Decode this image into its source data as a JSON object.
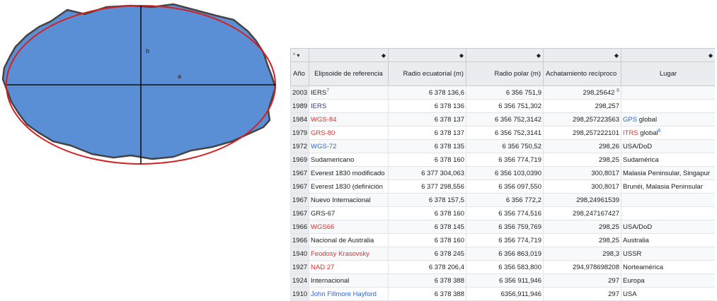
{
  "diagram": {
    "label_a": "a",
    "label_b": "b",
    "colors": {
      "fill": "#5a8fd6",
      "outline": "#444444",
      "ellipse": "#d42020"
    }
  },
  "table": {
    "sort_row": {
      "first": "° ▾",
      "sort_icon": "◆"
    },
    "headers": {
      "year": "Año",
      "ellipsoid": "Elipsoide de referencia",
      "equatorial": "Radio ecuatorial (m)",
      "polar": "Radio polar (m)",
      "flattening": "Achatamiento recíproco",
      "place": "Lugar"
    },
    "rows": [
      {
        "year": "2003",
        "name": "IERS",
        "name_sup": "7",
        "name_color": "plain",
        "eq": "6 378 136,6",
        "polar": "6 356 751,9",
        "flat": "298,25642",
        "flat_sup": "6",
        "place": "",
        "place_link": "",
        "place_tail": "",
        "place_sup": ""
      },
      {
        "year": "1989",
        "name": "IERS",
        "name_sup": "",
        "name_color": "blue-dark",
        "eq": "6 378 136",
        "polar": "6 356 751,302",
        "flat": "298,257",
        "flat_sup": "",
        "place": "",
        "place_link": "",
        "place_tail": "",
        "place_sup": ""
      },
      {
        "year": "1984",
        "name": "WGS-84",
        "name_sup": "",
        "name_color": "red",
        "eq": "6 378 137",
        "polar": "6 356 752,3142",
        "flat": "298,257223563",
        "flat_sup": "",
        "place": "",
        "place_link": "GPS",
        "place_tail": " global",
        "place_sup": ""
      },
      {
        "year": "1979",
        "name": "GRS-80",
        "name_sup": "",
        "name_color": "red",
        "eq": "6 378 137",
        "polar": "6 356 752,3141",
        "flat": "298,257222101",
        "flat_sup": "",
        "place": "",
        "place_link_red": "ITRS",
        "place_tail": " global",
        "place_sup": "6"
      },
      {
        "year": "1972",
        "name": "WGS-72",
        "name_sup": "",
        "name_color": "blue",
        "eq": "6 378 135",
        "polar": "6 356 750,52",
        "flat": "298,26",
        "flat_sup": "",
        "place": "USA/DoD",
        "place_link": "",
        "place_tail": "",
        "place_sup": ""
      },
      {
        "year": "1969",
        "name": "Sudamericano",
        "name_sup": "",
        "name_color": "plain",
        "eq": "6 378 160",
        "polar": "6 356 774,719",
        "flat": "298,25",
        "flat_sup": "",
        "place": "Sudamérica",
        "place_link": "",
        "place_tail": "",
        "place_sup": ""
      },
      {
        "year": "1967",
        "name": "Everest 1830 modificado",
        "name_sup": "",
        "name_color": "plain",
        "eq": "6 377 304,063",
        "polar": "6 356 103,0390",
        "flat": "300,8017",
        "flat_sup": "",
        "place": "Malasia Peninsular, Singapur",
        "place_link": "",
        "place_tail": "",
        "place_sup": ""
      },
      {
        "year": "1967",
        "name": "Everest 1830 (definición",
        "name_sup": "",
        "name_color": "plain",
        "eq": "6 377 298,556",
        "polar": "6 356 097,550",
        "flat": "300,8017",
        "flat_sup": "",
        "place": "Brunéi, Malasia Peninsular",
        "place_link": "",
        "place_tail": "",
        "place_sup": ""
      },
      {
        "year": "1967",
        "name": "Nuevo Internacional",
        "name_sup": "",
        "name_color": "plain",
        "eq": "6 378 157,5",
        "polar": "6 356 772,2",
        "flat": "298,24961539",
        "flat_sup": "",
        "place": "",
        "place_link": "",
        "place_tail": "",
        "place_sup": ""
      },
      {
        "year": "1967",
        "name": "GRS-67",
        "name_sup": "",
        "name_color": "plain",
        "eq": "6 378 160",
        "polar": "6 356 774,516",
        "flat": "298,247167427",
        "flat_sup": "",
        "place": "",
        "place_link": "",
        "place_tail": "",
        "place_sup": ""
      },
      {
        "year": "1966",
        "name": "WGS66",
        "name_sup": "",
        "name_color": "red",
        "eq": "6 378 145",
        "polar": "6 356 759,769",
        "flat": "298,25",
        "flat_sup": "",
        "place": "USA/DoD",
        "place_link": "",
        "place_tail": "",
        "place_sup": ""
      },
      {
        "year": "1966",
        "name": "Nacional de Australia",
        "name_sup": "",
        "name_color": "plain",
        "eq": "6 378 160",
        "polar": "6 356 774,719",
        "flat": "298,25",
        "flat_sup": "",
        "place": "Australia",
        "place_link": "",
        "place_tail": "",
        "place_sup": ""
      },
      {
        "year": "1940",
        "name": "Feodosy Krasovsky",
        "name_sup": "",
        "name_color": "red",
        "eq": "6 378 245",
        "polar": "6 356 863,019",
        "flat": "298,3",
        "flat_sup": "",
        "place": "USSR",
        "place_link": "",
        "place_tail": "",
        "place_sup": ""
      },
      {
        "year": "1927",
        "name": "NAD 27",
        "name_sup": "",
        "name_color": "red",
        "eq": "6 378 206,4",
        "polar": "6 356 583,800",
        "flat": "294,978698208",
        "flat_sup": "",
        "place": "Norteamérica",
        "place_link": "",
        "place_tail": "",
        "place_sup": ""
      },
      {
        "year": "1924",
        "name": "Internacional",
        "name_sup": "",
        "name_color": "plain",
        "eq": "6 378 388",
        "polar": "6 356 911,946",
        "flat": "297",
        "flat_sup": "",
        "place": "Europa",
        "place_link": "",
        "place_tail": "",
        "place_sup": ""
      },
      {
        "year": "1910",
        "name": "John Fillmore Hayford",
        "name_sup": "",
        "name_color": "blue",
        "eq": "6 378 388",
        "polar": "6356,911,946",
        "flat": "297",
        "flat_sup": "",
        "place": "USA",
        "place_link": "",
        "place_tail": "",
        "place_sup": ""
      }
    ]
  }
}
